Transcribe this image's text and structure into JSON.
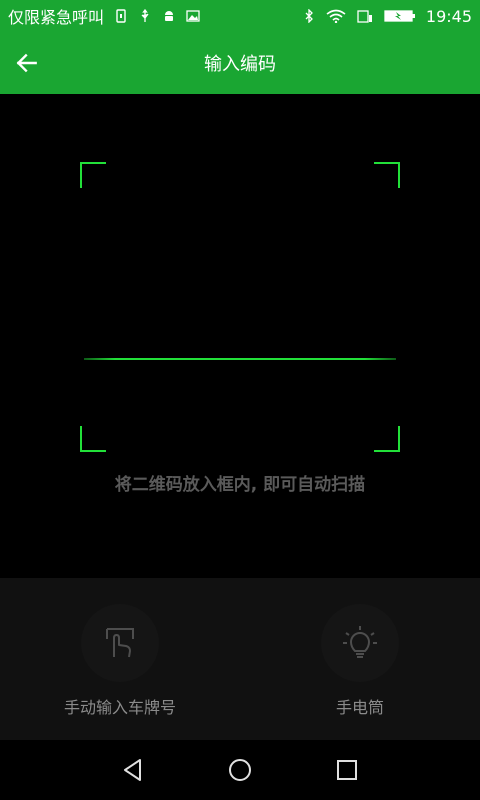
{
  "status_bar": {
    "carrier_text": "仅限紧急呼叫",
    "time": "19:45"
  },
  "app_bar": {
    "title": "输入编码"
  },
  "scan": {
    "hint": "将二维码放入框内, 即可自动扫描"
  },
  "actions": {
    "manual_input_label": "手动输入车牌号",
    "flashlight_label": "手电筒"
  },
  "colors": {
    "header_green": "#1aa632",
    "frame_green": "#22e039",
    "background": "#000000",
    "panel": "#111111"
  },
  "icons": {
    "back": "arrow-left-icon",
    "manual": "hand-pointer-icon",
    "flashlight": "lightbulb-icon"
  }
}
